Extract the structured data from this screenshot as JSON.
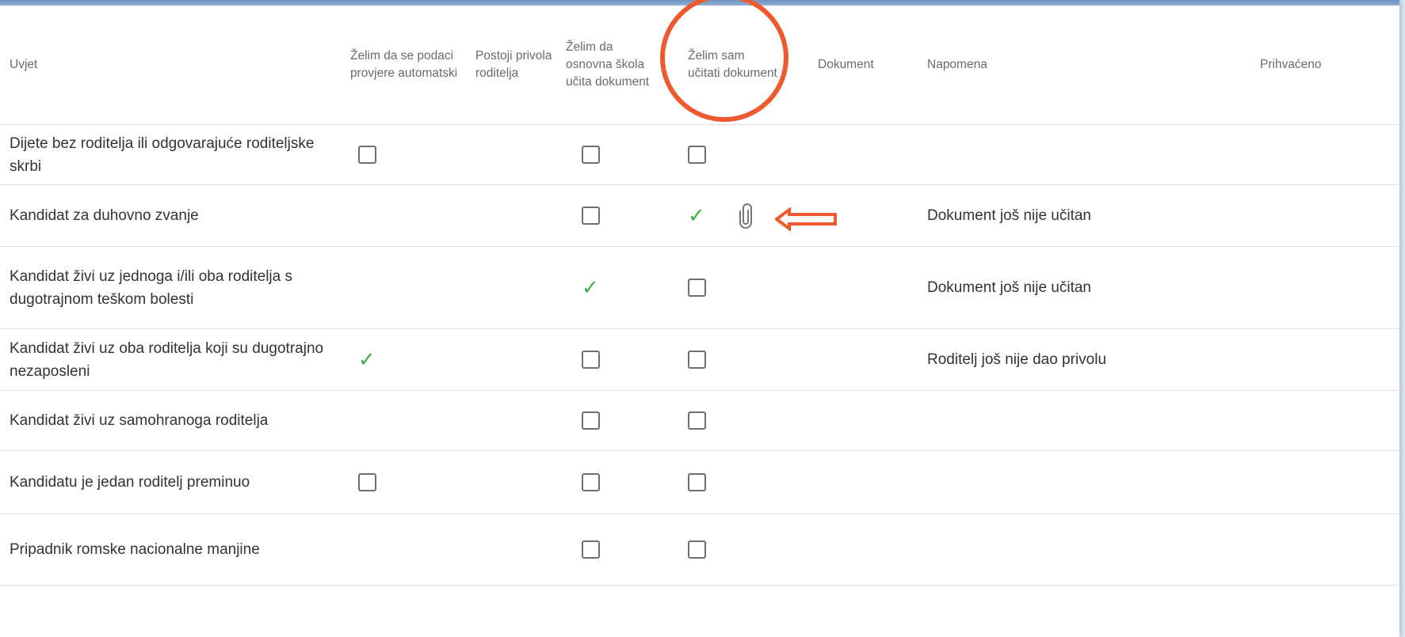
{
  "table": {
    "columns": [
      "Uvjet",
      "Želim da se podaci provjere automatski",
      "Postoji privola roditelja",
      "Želim da osnovna škola učita dokument",
      "Želim sam učitati dokument",
      "Dokument",
      "Napomena",
      "Prihvaćeno"
    ],
    "rows": [
      {
        "condition": "Dijete bez roditelja ili odgovarajuće roditeljske skrbi",
        "auto": "checkbox",
        "consent": "",
        "school": "checkbox",
        "self": "checkbox",
        "document": "",
        "note": "",
        "accepted": ""
      },
      {
        "condition": "Kandidat za duhovno zvanje",
        "auto": "",
        "consent": "",
        "school": "checkbox",
        "self": "check",
        "document": "paperclip",
        "note": "Dokument još nije učitan",
        "accepted": ""
      },
      {
        "condition": "Kandidat živi uz jednoga i/ili oba roditelja s dugotrajnom teškom bolesti",
        "auto": "",
        "consent": "",
        "school": "check",
        "self": "checkbox",
        "document": "",
        "note": "Dokument još nije učitan",
        "accepted": ""
      },
      {
        "condition": "Kandidat živi uz oba roditelja koji su dugotrajno nezaposleni",
        "auto": "check",
        "consent": "",
        "school": "checkbox",
        "self": "checkbox",
        "document": "",
        "note": "Roditelj još nije dao privolu",
        "accepted": ""
      },
      {
        "condition": "Kandidat živi uz samohranoga roditelja",
        "auto": "",
        "consent": "",
        "school": "checkbox",
        "self": "checkbox",
        "document": "",
        "note": "",
        "accepted": ""
      },
      {
        "condition": "Kandidatu je jedan roditelj preminuo",
        "auto": "checkbox",
        "consent": "",
        "school": "checkbox",
        "self": "checkbox",
        "document": "",
        "note": "",
        "accepted": ""
      },
      {
        "condition": "Pripadnik romske nacionalne manjine",
        "auto": "",
        "consent": "",
        "school": "checkbox",
        "self": "checkbox",
        "document": "",
        "note": "",
        "accepted": ""
      }
    ]
  },
  "colors": {
    "check": "#3fae49",
    "annotation": "#ee5a2e",
    "topbar": "#7a9cc6"
  }
}
